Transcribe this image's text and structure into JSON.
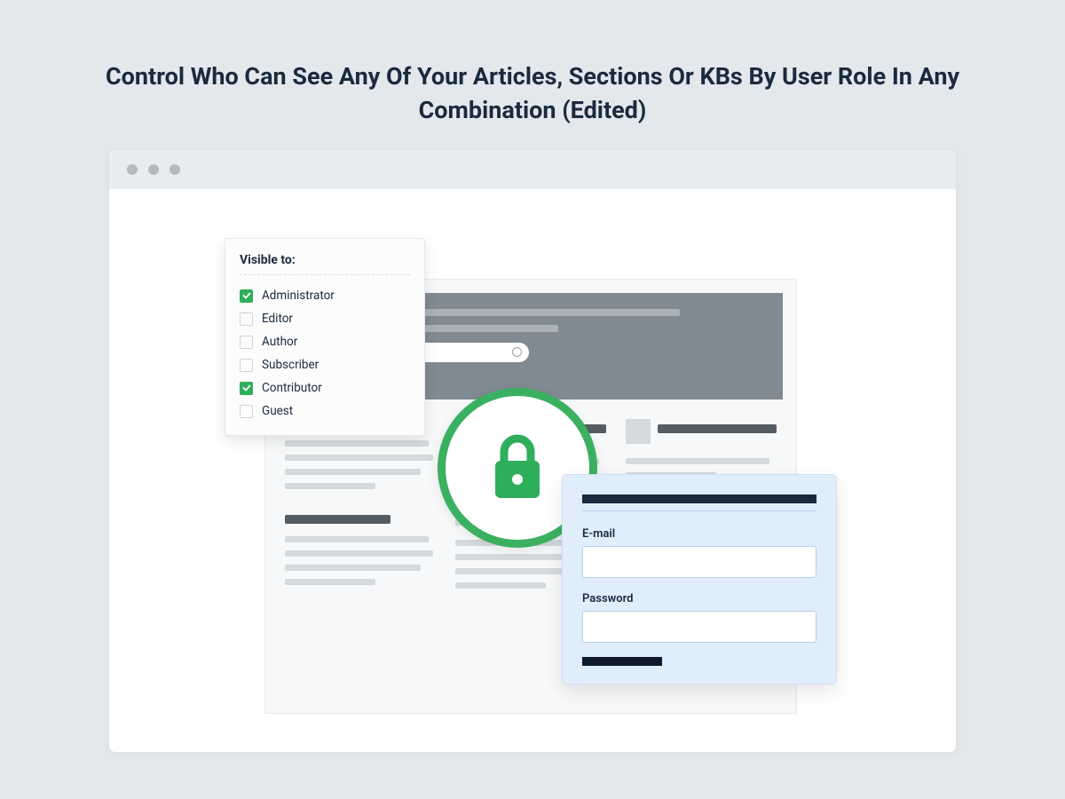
{
  "headline": "Control Who Can See Any Of Your Articles, Sections Or KBs By User Role In Any Combination (Edited)",
  "panel": {
    "title": "Visible to:",
    "roles": [
      {
        "label": "Administrator",
        "checked": true
      },
      {
        "label": "Editor",
        "checked": false
      },
      {
        "label": "Author",
        "checked": false
      },
      {
        "label": "Subscriber",
        "checked": false
      },
      {
        "label": "Contributor",
        "checked": true
      },
      {
        "label": "Guest",
        "checked": false
      }
    ]
  },
  "login": {
    "email_label": "E-mail",
    "password_label": "Password"
  },
  "colors": {
    "accent_green": "#3bb060",
    "dark_navy": "#1b2a3d"
  }
}
